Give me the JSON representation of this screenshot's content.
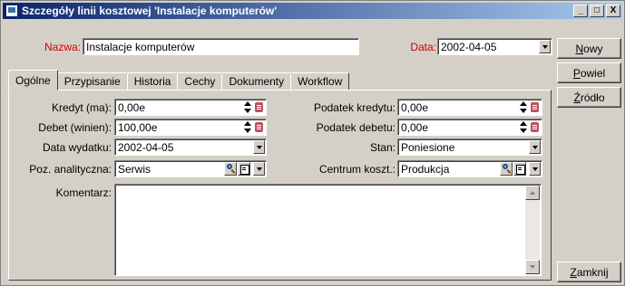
{
  "window": {
    "title": "Szczegóły linii kosztowej 'Instalacje komputerów'",
    "minimize": "_",
    "maximize": "□",
    "close": "X"
  },
  "header": {
    "name_label": "Nazwa:",
    "name_value": "Instalacje komputerów",
    "date_label": "Data:",
    "date_value": "2002-04-05"
  },
  "tabs": [
    {
      "label": "Ogólne"
    },
    {
      "label": "Przypisanie"
    },
    {
      "label": "Historia"
    },
    {
      "label": "Cechy"
    },
    {
      "label": "Dokumenty"
    },
    {
      "label": "Workflow"
    }
  ],
  "general": {
    "credit_label": "Kredyt (ma):",
    "credit_value": "0,00e",
    "debit_label": "Debet (winien):",
    "debit_value": "100,00e",
    "expense_date_label": "Data wydatku:",
    "expense_date_value": "2002-04-05",
    "analytic_label": "Poz. analityczna:",
    "analytic_value": "Serwis",
    "comment_label": "Komentarz:",
    "credit_tax_label": "Podatek kredytu:",
    "credit_tax_value": "0,00e",
    "debit_tax_label": "Podatek debetu:",
    "debit_tax_value": "0,00e",
    "status_label": "Stan:",
    "status_value": "Poniesione",
    "cost_center_label": "Centrum koszt.:",
    "cost_center_value": "Produkcja"
  },
  "buttons": {
    "new": {
      "mnemonic": "N",
      "rest": "owy"
    },
    "duplicate": {
      "mnemonic": "P",
      "rest": "owiel"
    },
    "source": {
      "mnemonic": "Ź",
      "rest": "ródło"
    },
    "close": {
      "mnemonic": "Z",
      "rest": "amknij"
    }
  },
  "colors": {
    "title_bar_start": "#0a246a",
    "title_bar_end": "#a6caf0",
    "required_label": "#d00000",
    "face": "#d4d0c8"
  }
}
